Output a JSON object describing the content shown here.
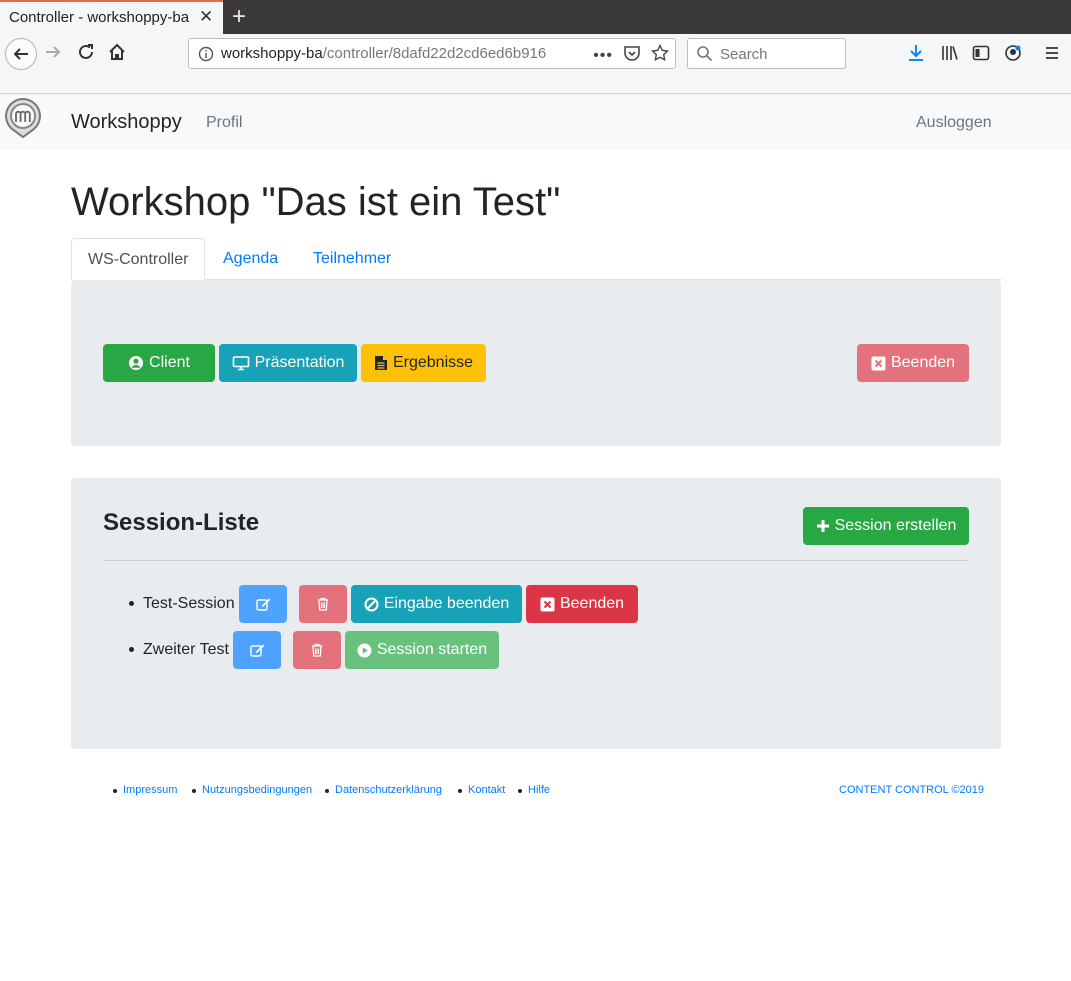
{
  "browser": {
    "tab_title": "Controller - workshoppy-ba",
    "url_host": "workshoppy-ba",
    "url_path": "/controller/8dafd22d2cd6ed6b916",
    "search_placeholder": "Search"
  },
  "navbar": {
    "brand": "Workshoppy",
    "profile": "Profil",
    "logout": "Ausloggen"
  },
  "page": {
    "title": "Workshop \"Das ist ein Test\""
  },
  "tabs": [
    {
      "label": "WS-Controller",
      "active": true
    },
    {
      "label": "Agenda",
      "active": false
    },
    {
      "label": "Teilnehmer",
      "active": false
    }
  ],
  "controller": {
    "client": "Client",
    "presentation": "Präsentation",
    "results": "Ergebnisse",
    "end": "Beenden"
  },
  "sessions": {
    "title": "Session-Liste",
    "create": "Session erstellen",
    "items": [
      {
        "name": "Test-Session",
        "action1": "Eingabe beenden",
        "action2": "Beenden"
      },
      {
        "name": "Zweiter Test",
        "action1": "Session starten"
      }
    ]
  },
  "footer": {
    "links": [
      "Impressum",
      "Nutzungsbedingungen",
      "Datenschutzerklärung",
      "Kontakt",
      "Hilfe"
    ],
    "copyright": "CONTENT CONTROL ©2019"
  },
  "colors": {
    "success": "#28a745",
    "info": "#17a2b8",
    "warning": "#ffc107",
    "danger": "#dc3545",
    "primary": "#007bff"
  }
}
